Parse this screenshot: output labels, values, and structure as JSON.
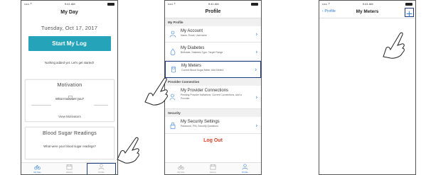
{
  "status": {
    "carrier": "••••• ⇡",
    "time": "9:41 AM"
  },
  "screen1": {
    "title": "My Day",
    "date": "Tuesday, Oct 17, 2017",
    "start_button": "Start My Log",
    "empty_message": "Nothing added yet. Let's get started!",
    "motivation": {
      "title": "Motivation",
      "question": "What motivates you?",
      "link": "View Motivators"
    },
    "readings": {
      "title": "Blood Sugar Readings",
      "question": "What were your blood sugar readings?"
    }
  },
  "tabs": [
    {
      "label": "My Day",
      "icon": "bike-icon"
    },
    {
      "label": "History",
      "icon": "calendar-icon"
    },
    {
      "label": "Profile",
      "icon": "person-icon"
    }
  ],
  "screen2": {
    "title": "Profile",
    "sections": {
      "my_profile": "My Profile",
      "provider": "Provider Connection",
      "security": "Security"
    },
    "rows": {
      "account": {
        "title": "My Account",
        "sub": "Name, Email, Username"
      },
      "diabetes": {
        "title": "My Diabetes",
        "sub": "Birthdate, Diabetes Type, Target Range"
      },
      "meters": {
        "title": "My Meters",
        "sub": "Current Blood Sugar Meter, Add Meters"
      },
      "connections": {
        "title": "My Provider Connections",
        "sub": "Pending Provider Invitations, Current Connections, Add a Provider"
      },
      "security": {
        "title": "My Security Settings",
        "sub": "Password, PIN, Security Questions"
      }
    },
    "logout": "Log Out"
  },
  "screen3": {
    "back": "Profile",
    "title": "My Meters"
  },
  "colors": {
    "accent": "#25a3b8",
    "link": "#2b7bd8",
    "highlight": "#1e3d82",
    "logout": "#d9412c"
  }
}
